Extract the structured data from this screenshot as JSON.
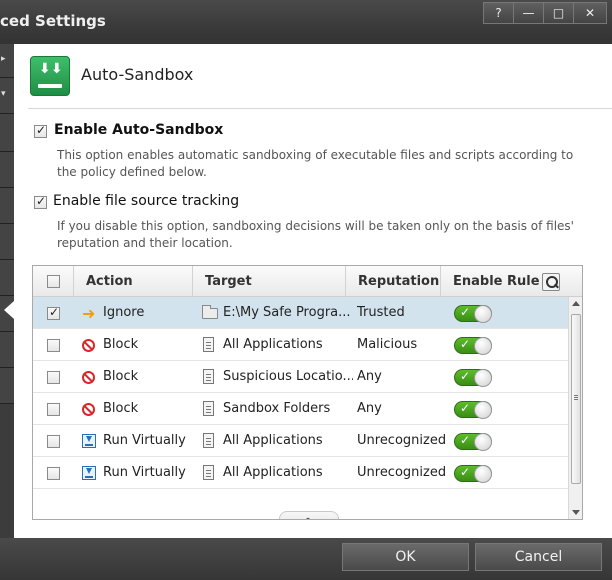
{
  "window": {
    "title": "ced Settings",
    "help_label": "?",
    "minimize_label": "—",
    "maximize_label": "□",
    "close_label": "✕"
  },
  "header": {
    "title": "Auto-Sandbox",
    "icon": "sandbox-download-icon",
    "accent": "#2aa155"
  },
  "options": [
    {
      "checked": true,
      "label": "Enable Auto-Sandbox",
      "description": "This option enables automatic sandboxing of executable files and scripts according to the policy defined below."
    },
    {
      "checked": true,
      "label": "Enable file source tracking",
      "description": "If you disable this option, sandboxing decisions will be taken only on the basis of files' reputation and their location."
    }
  ],
  "table": {
    "headers": {
      "action": "Action",
      "target": "Target",
      "reputation": "Reputation",
      "enable_rule": "Enable Rule"
    },
    "rows": [
      {
        "checked": true,
        "selected": true,
        "action_icon": "arrow-right-icon",
        "action": "Ignore",
        "target_icon": "folder-icon",
        "target": "E:\\My Safe Progra...",
        "reputation": "Trusted",
        "enabled": true
      },
      {
        "checked": false,
        "selected": false,
        "action_icon": "block-icon",
        "action": "Block",
        "target_icon": "documents-icon",
        "target": "All Applications",
        "reputation": "Malicious",
        "enabled": true
      },
      {
        "checked": false,
        "selected": false,
        "action_icon": "block-icon",
        "action": "Block",
        "target_icon": "documents-icon",
        "target": "Suspicious Locatio...",
        "reputation": "Any",
        "enabled": true
      },
      {
        "checked": false,
        "selected": false,
        "action_icon": "block-icon",
        "action": "Block",
        "target_icon": "documents-icon",
        "target": "Sandbox Folders",
        "reputation": "Any",
        "enabled": true
      },
      {
        "checked": false,
        "selected": false,
        "action_icon": "run-virtually-icon",
        "action": "Run Virtually",
        "target_icon": "documents-icon",
        "target": "All Applications",
        "reputation": "Unrecognized",
        "enabled": true
      },
      {
        "checked": false,
        "selected": false,
        "action_icon": "run-virtually-icon",
        "action": "Run Virtually",
        "target_icon": "documents-icon",
        "target": "All Applications",
        "reputation": "Unrecognized",
        "enabled": true
      }
    ]
  },
  "footer": {
    "ok_label": "OK",
    "cancel_label": "Cancel"
  },
  "colors": {
    "selected_row": "#d3e3ee",
    "toggle_on": "#4aa520",
    "block_red": "#d9262b",
    "ignore_orange": "#f39c12"
  }
}
